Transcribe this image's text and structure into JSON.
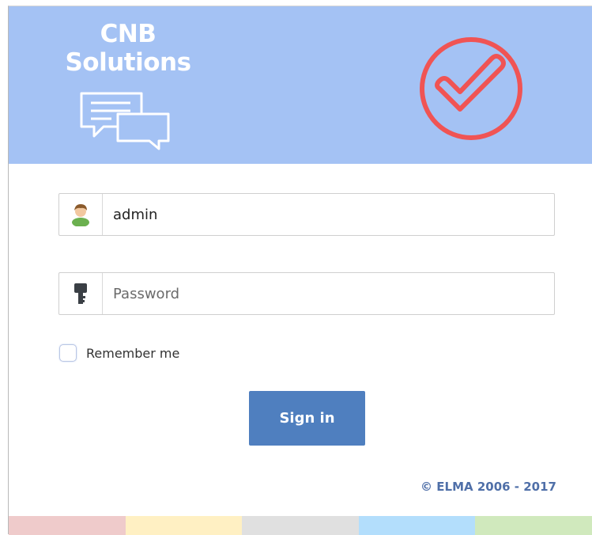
{
  "header": {
    "logo_line1": "CNB",
    "logo_line2": "Solutions",
    "logo_icon": "chat-bubbles-icon",
    "badge_icon": "checkmark-circle-icon",
    "background_color": "#a4c2f4",
    "check_color": "#f05454"
  },
  "login_form": {
    "username_icon": "user-icon",
    "username_value": "admin",
    "password_icon": "key-icon",
    "password_placeholder": "Password",
    "remember_label": "Remember me",
    "remember_checked": false,
    "signin_label": "Sign in",
    "signin_color": "#4f7fbf"
  },
  "footer": {
    "copyright": "© ELMA 2006 - 2017",
    "stripe_colors": [
      "#efcbcb",
      "#fff0c3",
      "#e0e0e0",
      "#b3defc",
      "#d0e9bd"
    ]
  }
}
